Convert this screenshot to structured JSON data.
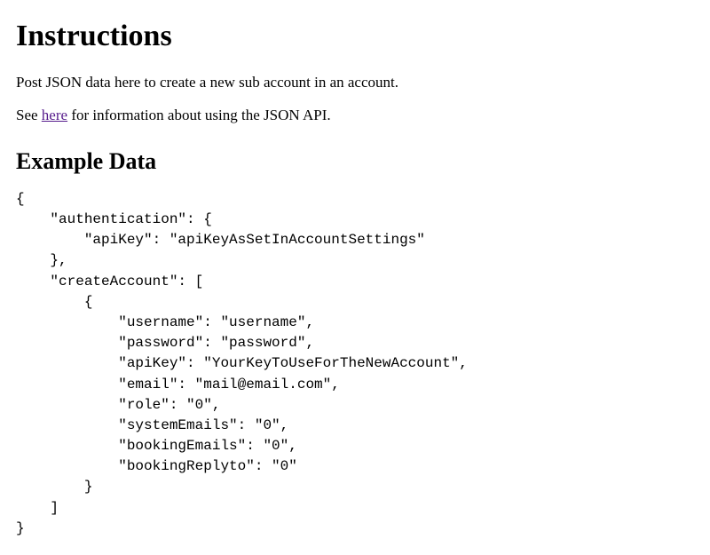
{
  "headings": {
    "instructions": "Instructions",
    "exampleData": "Example Data"
  },
  "intro": {
    "line1": "Post JSON data here to create a new sub account in an account.",
    "line2_pre": "See ",
    "line2_link": "here",
    "line2_post": " for information about using the JSON API."
  },
  "code_block": "{\n    \"authentication\": {\n        \"apiKey\": \"apiKeyAsSetInAccountSettings\"\n    },\n    \"createAccount\": [\n        {\n            \"username\": \"username\",\n            \"password\": \"password\",\n            \"apiKey\": \"YourKeyToUseForTheNewAccount\",\n            \"email\": \"mail@email.com\",\n            \"role\": \"0\",\n            \"systemEmails\": \"0\",\n            \"bookingEmails\": \"0\",\n            \"bookingReplyto\": \"0\"\n        }\n    ]\n}"
}
